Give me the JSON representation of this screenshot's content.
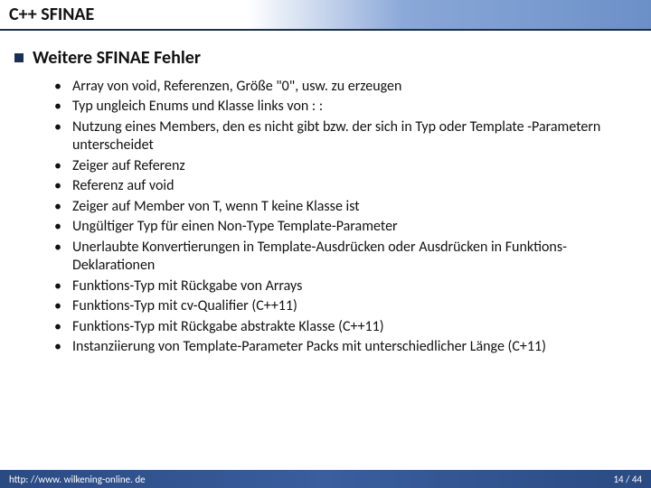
{
  "header": {
    "title": "C++ SFINAE"
  },
  "section": {
    "heading": "Weitere SFINAE Fehler",
    "items": [
      "Array von void, Referenzen, Größe \"0\", usw. zu erzeugen",
      "Typ ungleich Enums und Klasse links von : :",
      "Nutzung eines Members, den es nicht gibt bzw. der sich in Typ oder Template -Parametern unterscheidet",
      "Zeiger auf Referenz",
      "Referenz auf void",
      "Zeiger auf Member von T, wenn T keine Klasse ist",
      "Ungültiger Typ für einen Non-Type Template-Parameter",
      "Unerlaubte Konvertierungen in Template-Ausdrücken oder Ausdrücken in Funktions-Deklarationen",
      "Funktions-Typ mit Rückgabe von Arrays",
      "Funktions-Typ mit cv-Qualifier (C++11)",
      "Funktions-Typ mit Rückgabe abstrakte Klasse (C++11)",
      "Instanziierung von Template-Parameter Packs mit unterschiedlicher Länge (C+11)"
    ]
  },
  "footer": {
    "url": "http: //www. wilkening-online. de",
    "page": "14 / 44"
  }
}
